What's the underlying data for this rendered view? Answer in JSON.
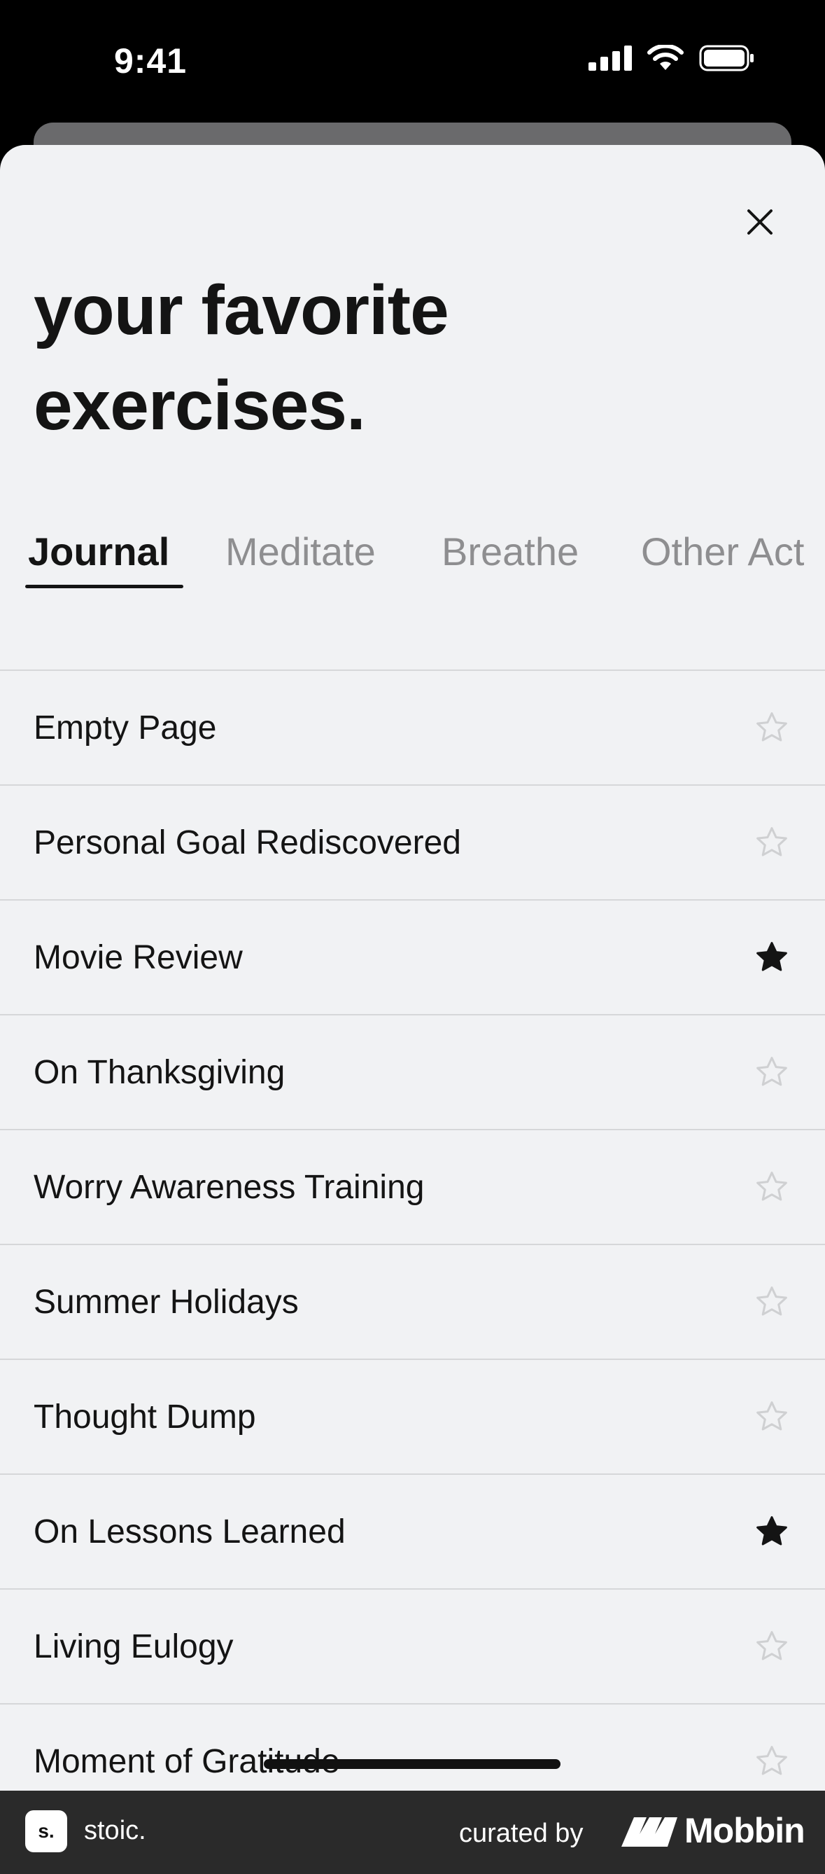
{
  "status_bar": {
    "time": "9:41"
  },
  "header": {
    "title": "your favorite exercises."
  },
  "tabs": [
    {
      "label": "Journal",
      "active": true
    },
    {
      "label": "Meditate",
      "active": false
    },
    {
      "label": "Breathe",
      "active": false
    },
    {
      "label": "Other Act",
      "active": false
    }
  ],
  "exercises": [
    {
      "title": "Empty Page",
      "favorite": false
    },
    {
      "title": "Personal Goal Rediscovered",
      "favorite": false
    },
    {
      "title": "Movie Review",
      "favorite": true
    },
    {
      "title": "On Thanksgiving",
      "favorite": false
    },
    {
      "title": "Worry Awareness Training",
      "favorite": false
    },
    {
      "title": "Summer Holidays",
      "favorite": false
    },
    {
      "title": "Thought Dump",
      "favorite": false
    },
    {
      "title": "On Lessons Learned",
      "favorite": true
    },
    {
      "title": "Living Eulogy",
      "favorite": false
    },
    {
      "title": "Moment of Gratitude",
      "favorite": false
    }
  ],
  "footer": {
    "app_logo": "s.",
    "app_name": "stoic.",
    "curated_label": "curated by",
    "brand_name": "Mobbin"
  },
  "colors": {
    "sheet_background": "#f1f2f4",
    "text_primary": "#141414",
    "tab_inactive": "#8e8e90",
    "star_outline": "#cfd0d2",
    "star_filled": "#141414",
    "footer_background": "#2a2a2a"
  },
  "icons": {
    "close": "close-icon",
    "favorite_on": "star-filled-icon",
    "favorite_off": "star-outline-icon",
    "signal": "cellular-signal-icon",
    "wifi": "wifi-icon",
    "battery": "battery-icon"
  }
}
